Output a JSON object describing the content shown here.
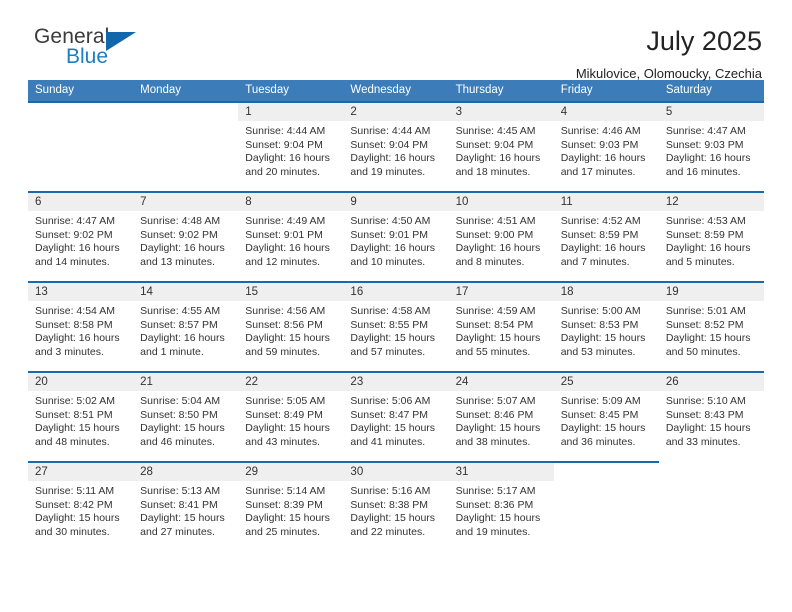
{
  "brand": {
    "name_part1": "General",
    "name_part2": "Blue",
    "triangle_icon": "triangle-icon",
    "accent_color": "#1f7dc4"
  },
  "header": {
    "title": "July 2025",
    "subtitle": "Mikulovice, Olomoucky, Czechia"
  },
  "calendar": {
    "header_color": "#3c7cb8",
    "rule_color": "#1a69ad",
    "day_band_color": "#efefef",
    "weekdays": [
      "Sunday",
      "Monday",
      "Tuesday",
      "Wednesday",
      "Thursday",
      "Friday",
      "Saturday"
    ],
    "weeks": [
      [
        {
          "date": "",
          "sunrise": "",
          "sunset": "",
          "daylight": "",
          "empty": true
        },
        {
          "date": "",
          "sunrise": "",
          "sunset": "",
          "daylight": "",
          "empty": true
        },
        {
          "date": "1",
          "sunrise": "Sunrise: 4:44 AM",
          "sunset": "Sunset: 9:04 PM",
          "daylight": "Daylight: 16 hours and 20 minutes."
        },
        {
          "date": "2",
          "sunrise": "Sunrise: 4:44 AM",
          "sunset": "Sunset: 9:04 PM",
          "daylight": "Daylight: 16 hours and 19 minutes."
        },
        {
          "date": "3",
          "sunrise": "Sunrise: 4:45 AM",
          "sunset": "Sunset: 9:04 PM",
          "daylight": "Daylight: 16 hours and 18 minutes."
        },
        {
          "date": "4",
          "sunrise": "Sunrise: 4:46 AM",
          "sunset": "Sunset: 9:03 PM",
          "daylight": "Daylight: 16 hours and 17 minutes."
        },
        {
          "date": "5",
          "sunrise": "Sunrise: 4:47 AM",
          "sunset": "Sunset: 9:03 PM",
          "daylight": "Daylight: 16 hours and 16 minutes."
        }
      ],
      [
        {
          "date": "6",
          "sunrise": "Sunrise: 4:47 AM",
          "sunset": "Sunset: 9:02 PM",
          "daylight": "Daylight: 16 hours and 14 minutes."
        },
        {
          "date": "7",
          "sunrise": "Sunrise: 4:48 AM",
          "sunset": "Sunset: 9:02 PM",
          "daylight": "Daylight: 16 hours and 13 minutes."
        },
        {
          "date": "8",
          "sunrise": "Sunrise: 4:49 AM",
          "sunset": "Sunset: 9:01 PM",
          "daylight": "Daylight: 16 hours and 12 minutes."
        },
        {
          "date": "9",
          "sunrise": "Sunrise: 4:50 AM",
          "sunset": "Sunset: 9:01 PM",
          "daylight": "Daylight: 16 hours and 10 minutes."
        },
        {
          "date": "10",
          "sunrise": "Sunrise: 4:51 AM",
          "sunset": "Sunset: 9:00 PM",
          "daylight": "Daylight: 16 hours and 8 minutes."
        },
        {
          "date": "11",
          "sunrise": "Sunrise: 4:52 AM",
          "sunset": "Sunset: 8:59 PM",
          "daylight": "Daylight: 16 hours and 7 minutes."
        },
        {
          "date": "12",
          "sunrise": "Sunrise: 4:53 AM",
          "sunset": "Sunset: 8:59 PM",
          "daylight": "Daylight: 16 hours and 5 minutes."
        }
      ],
      [
        {
          "date": "13",
          "sunrise": "Sunrise: 4:54 AM",
          "sunset": "Sunset: 8:58 PM",
          "daylight": "Daylight: 16 hours and 3 minutes."
        },
        {
          "date": "14",
          "sunrise": "Sunrise: 4:55 AM",
          "sunset": "Sunset: 8:57 PM",
          "daylight": "Daylight: 16 hours and 1 minute."
        },
        {
          "date": "15",
          "sunrise": "Sunrise: 4:56 AM",
          "sunset": "Sunset: 8:56 PM",
          "daylight": "Daylight: 15 hours and 59 minutes."
        },
        {
          "date": "16",
          "sunrise": "Sunrise: 4:58 AM",
          "sunset": "Sunset: 8:55 PM",
          "daylight": "Daylight: 15 hours and 57 minutes."
        },
        {
          "date": "17",
          "sunrise": "Sunrise: 4:59 AM",
          "sunset": "Sunset: 8:54 PM",
          "daylight": "Daylight: 15 hours and 55 minutes."
        },
        {
          "date": "18",
          "sunrise": "Sunrise: 5:00 AM",
          "sunset": "Sunset: 8:53 PM",
          "daylight": "Daylight: 15 hours and 53 minutes."
        },
        {
          "date": "19",
          "sunrise": "Sunrise: 5:01 AM",
          "sunset": "Sunset: 8:52 PM",
          "daylight": "Daylight: 15 hours and 50 minutes."
        }
      ],
      [
        {
          "date": "20",
          "sunrise": "Sunrise: 5:02 AM",
          "sunset": "Sunset: 8:51 PM",
          "daylight": "Daylight: 15 hours and 48 minutes."
        },
        {
          "date": "21",
          "sunrise": "Sunrise: 5:04 AM",
          "sunset": "Sunset: 8:50 PM",
          "daylight": "Daylight: 15 hours and 46 minutes."
        },
        {
          "date": "22",
          "sunrise": "Sunrise: 5:05 AM",
          "sunset": "Sunset: 8:49 PM",
          "daylight": "Daylight: 15 hours and 43 minutes."
        },
        {
          "date": "23",
          "sunrise": "Sunrise: 5:06 AM",
          "sunset": "Sunset: 8:47 PM",
          "daylight": "Daylight: 15 hours and 41 minutes."
        },
        {
          "date": "24",
          "sunrise": "Sunrise: 5:07 AM",
          "sunset": "Sunset: 8:46 PM",
          "daylight": "Daylight: 15 hours and 38 minutes."
        },
        {
          "date": "25",
          "sunrise": "Sunrise: 5:09 AM",
          "sunset": "Sunset: 8:45 PM",
          "daylight": "Daylight: 15 hours and 36 minutes."
        },
        {
          "date": "26",
          "sunrise": "Sunrise: 5:10 AM",
          "sunset": "Sunset: 8:43 PM",
          "daylight": "Daylight: 15 hours and 33 minutes."
        }
      ],
      [
        {
          "date": "27",
          "sunrise": "Sunrise: 5:11 AM",
          "sunset": "Sunset: 8:42 PM",
          "daylight": "Daylight: 15 hours and 30 minutes."
        },
        {
          "date": "28",
          "sunrise": "Sunrise: 5:13 AM",
          "sunset": "Sunset: 8:41 PM",
          "daylight": "Daylight: 15 hours and 27 minutes."
        },
        {
          "date": "29",
          "sunrise": "Sunrise: 5:14 AM",
          "sunset": "Sunset: 8:39 PM",
          "daylight": "Daylight: 15 hours and 25 minutes."
        },
        {
          "date": "30",
          "sunrise": "Sunrise: 5:16 AM",
          "sunset": "Sunset: 8:38 PM",
          "daylight": "Daylight: 15 hours and 22 minutes."
        },
        {
          "date": "31",
          "sunrise": "Sunrise: 5:17 AM",
          "sunset": "Sunset: 8:36 PM",
          "daylight": "Daylight: 15 hours and 19 minutes."
        },
        {
          "date": "",
          "sunrise": "",
          "sunset": "",
          "daylight": "",
          "empty": true
        },
        {
          "date": "",
          "sunrise": "",
          "sunset": "",
          "daylight": "",
          "empty": true
        }
      ]
    ]
  }
}
